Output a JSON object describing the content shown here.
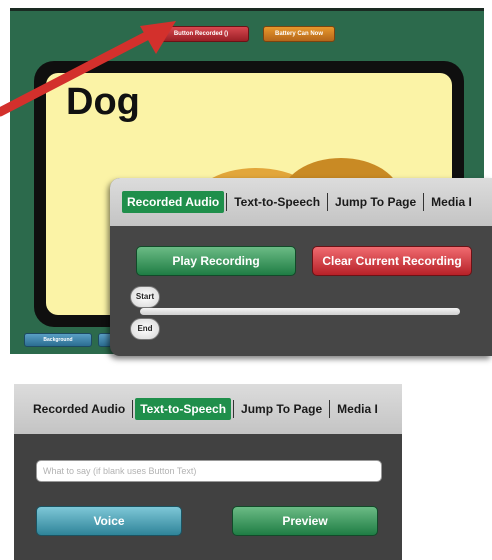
{
  "top_screenshot": {
    "top_buttons": [
      "Button Recorded ()",
      "Battery Can Now"
    ],
    "card_word": "Dog",
    "bottom_buttons": [
      "Background"
    ]
  },
  "audio_panel": {
    "tabs": [
      "Recorded Audio",
      "Text-to-Speech",
      "Jump To Page",
      "Media I"
    ],
    "active_tab": "Recorded Audio",
    "play_label": "Play Recording",
    "clear_label": "Clear Current Recording",
    "slider_start_label": "Start",
    "slider_end_label": "End"
  },
  "tts_panel": {
    "tabs": [
      "Recorded Audio",
      "Text-to-Speech",
      "Jump To Page",
      "Media I"
    ],
    "active_tab": "Text-to-Speech",
    "input_placeholder": "What to say (if blank uses Button Text)",
    "voice_label": "Voice",
    "preview_label": "Preview"
  },
  "colors": {
    "app_green": "#2c6a4c",
    "tab_active": "#1f8f4b",
    "arrow": "#d3302c",
    "card_bg": "#fbf3a6"
  }
}
